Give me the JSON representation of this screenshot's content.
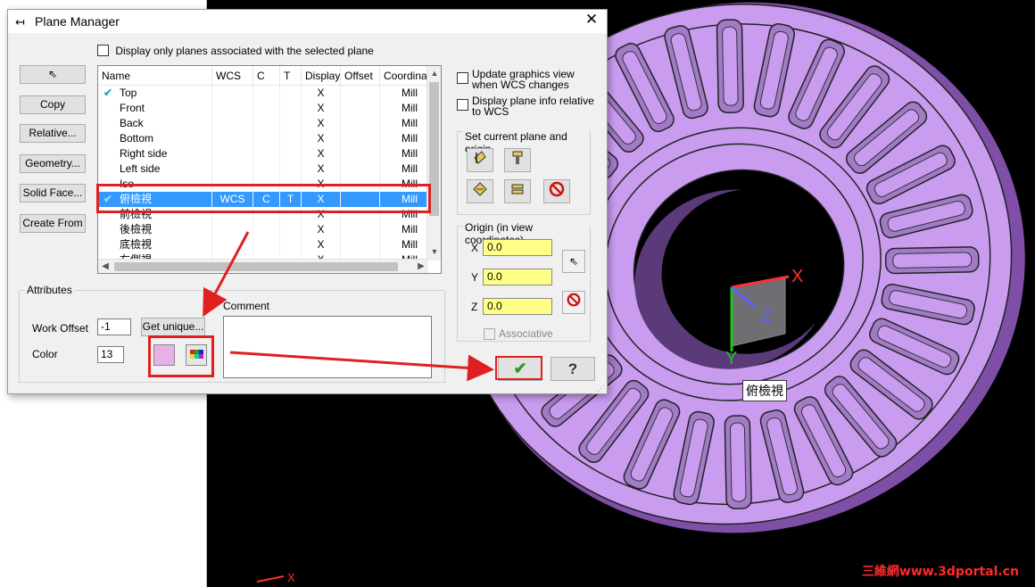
{
  "window": {
    "title": "Plane Manager",
    "title_icon": "↤",
    "close_glyph": "✕"
  },
  "options": {
    "display_associated": "Display only planes associated with the selected plane",
    "update_graphics": "Update graphics view when WCS changes",
    "display_plane_info": "Display plane info relative to WCS"
  },
  "side_buttons": {
    "cursor": "⇖",
    "copy": "Copy",
    "relative": "Relative...",
    "geometry": "Geometry...",
    "solid_face": "Solid Face...",
    "create_from": "Create From"
  },
  "table": {
    "columns": [
      "Name",
      "WCS",
      "C",
      "T",
      "Display",
      "Offset",
      "Coordinat"
    ],
    "rows": [
      {
        "check": "✔",
        "name": "Top",
        "wcs": "",
        "c": "",
        "t": "",
        "display": "X",
        "offset": "",
        "coord": "Mill"
      },
      {
        "check": "",
        "name": "Front",
        "wcs": "",
        "c": "",
        "t": "",
        "display": "X",
        "offset": "",
        "coord": "Mill"
      },
      {
        "check": "",
        "name": "Back",
        "wcs": "",
        "c": "",
        "t": "",
        "display": "X",
        "offset": "",
        "coord": "Mill"
      },
      {
        "check": "",
        "name": "Bottom",
        "wcs": "",
        "c": "",
        "t": "",
        "display": "X",
        "offset": "",
        "coord": "Mill"
      },
      {
        "check": "",
        "name": "Right side",
        "wcs": "",
        "c": "",
        "t": "",
        "display": "X",
        "offset": "",
        "coord": "Mill"
      },
      {
        "check": "",
        "name": "Left side",
        "wcs": "",
        "c": "",
        "t": "",
        "display": "X",
        "offset": "",
        "coord": "Mill"
      },
      {
        "check": "",
        "name": "Iso",
        "wcs": "",
        "c": "",
        "t": "",
        "display": "X",
        "offset": "",
        "coord": "Mill"
      },
      {
        "check": "✔",
        "name": "俯檢視",
        "wcs": "WCS",
        "c": "C",
        "t": "T",
        "display": "X",
        "offset": "",
        "coord": "Mill"
      },
      {
        "check": "",
        "name": "前檢視",
        "wcs": "",
        "c": "",
        "t": "",
        "display": "X",
        "offset": "",
        "coord": "Mill"
      },
      {
        "check": "",
        "name": "後檢視",
        "wcs": "",
        "c": "",
        "t": "",
        "display": "X",
        "offset": "",
        "coord": "Mill"
      },
      {
        "check": "",
        "name": "底檢視",
        "wcs": "",
        "c": "",
        "t": "",
        "display": "X",
        "offset": "",
        "coord": "Mill"
      },
      {
        "check": "",
        "name": "右側視",
        "wcs": "",
        "c": "",
        "t": "",
        "display": "X",
        "offset": "",
        "coord": "Mill"
      }
    ],
    "selected_index": 7
  },
  "set_current": {
    "title": "Set current plane and origin"
  },
  "origin": {
    "title": "Origin (in view coordinates)",
    "x_label": "X",
    "y_label": "Y",
    "z_label": "Z",
    "x_value": "0.0",
    "y_value": "0.0",
    "z_value": "0.0",
    "associative": "Associative"
  },
  "attributes": {
    "title": "Attributes",
    "work_offset_label": "Work Offset",
    "work_offset_value": "-1",
    "get_unique": "Get unique...",
    "color_label": "Color",
    "color_value": "13",
    "swatch_color": "#e8b0e8",
    "comment_label": "Comment"
  },
  "actions": {
    "ok_glyph": "✔",
    "help_glyph": "?"
  },
  "viewport": {
    "axis_x": "X",
    "axis_y": "Y",
    "axis_z": "Z",
    "plane_label": "俯檢視",
    "corner_x": "X",
    "model_color": "#c99cf0",
    "watermark": "三維網www.3dportal.cn"
  },
  "colors": {
    "highlight": "#e02020",
    "selection": "#3399ff"
  }
}
